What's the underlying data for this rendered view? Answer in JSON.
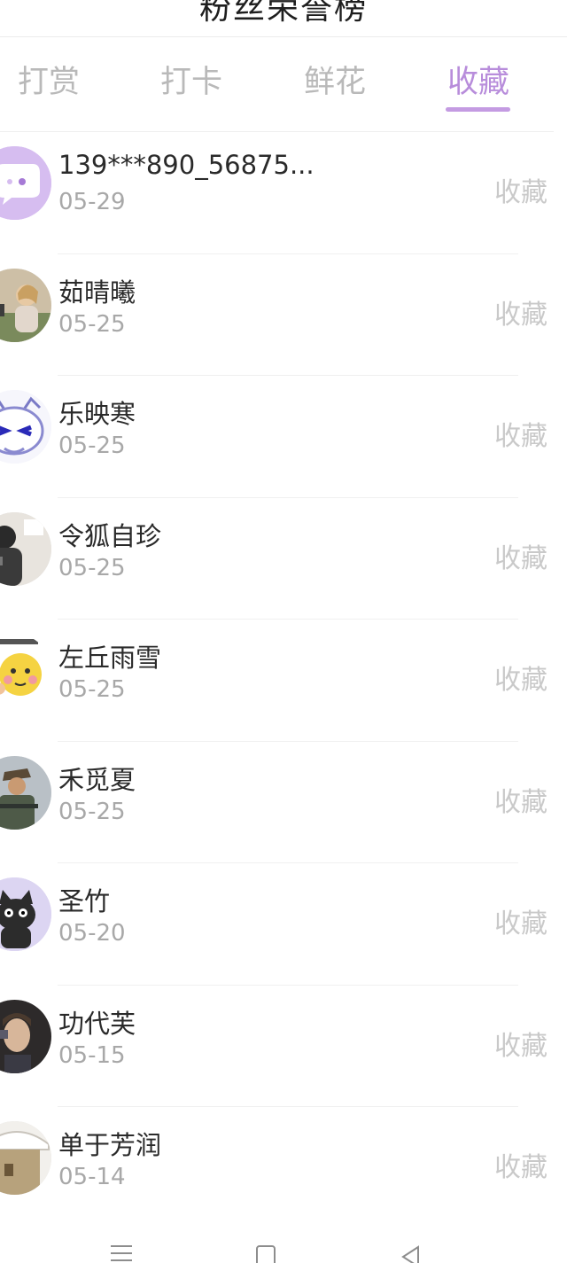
{
  "header": {
    "title": "粉丝荣誉榜"
  },
  "tabs": [
    {
      "label": "打赏",
      "active": false
    },
    {
      "label": "打卡",
      "active": false
    },
    {
      "label": "鲜花",
      "active": false
    },
    {
      "label": "收藏",
      "active": true
    }
  ],
  "colors": {
    "accent": "#b88ddb",
    "tab_inactive": "#b9b9b9",
    "date": "#a8a8a8",
    "action": "#c9c9c9"
  },
  "list": [
    {
      "name": "139***890_56875...",
      "date": "05-29",
      "action": "收藏",
      "avatar": "chat-bubble-avatar"
    },
    {
      "name": "茹晴曦",
      "date": "05-25",
      "action": "收藏",
      "avatar": "photo-avatar"
    },
    {
      "name": "乐映寒",
      "date": "05-25",
      "action": "收藏",
      "avatar": "cartoon-avatar"
    },
    {
      "name": "令狐自珍",
      "date": "05-25",
      "action": "收藏",
      "avatar": "photo-avatar"
    },
    {
      "name": "左丘雨雪",
      "date": "05-25",
      "action": "收藏",
      "avatar": "emoji-avatar"
    },
    {
      "name": "禾觅夏",
      "date": "05-25",
      "action": "收藏",
      "avatar": "photo-avatar"
    },
    {
      "name": "圣竹",
      "date": "05-20",
      "action": "收藏",
      "avatar": "cat-avatar"
    },
    {
      "name": "功代芙",
      "date": "05-15",
      "action": "收藏",
      "avatar": "photo-avatar"
    },
    {
      "name": "单于芳润",
      "date": "05-14",
      "action": "收藏",
      "avatar": "photo-avatar"
    }
  ],
  "navbar": {
    "menu_icon": "menu-icon",
    "home_icon": "home-icon",
    "back_icon": "back-icon"
  }
}
